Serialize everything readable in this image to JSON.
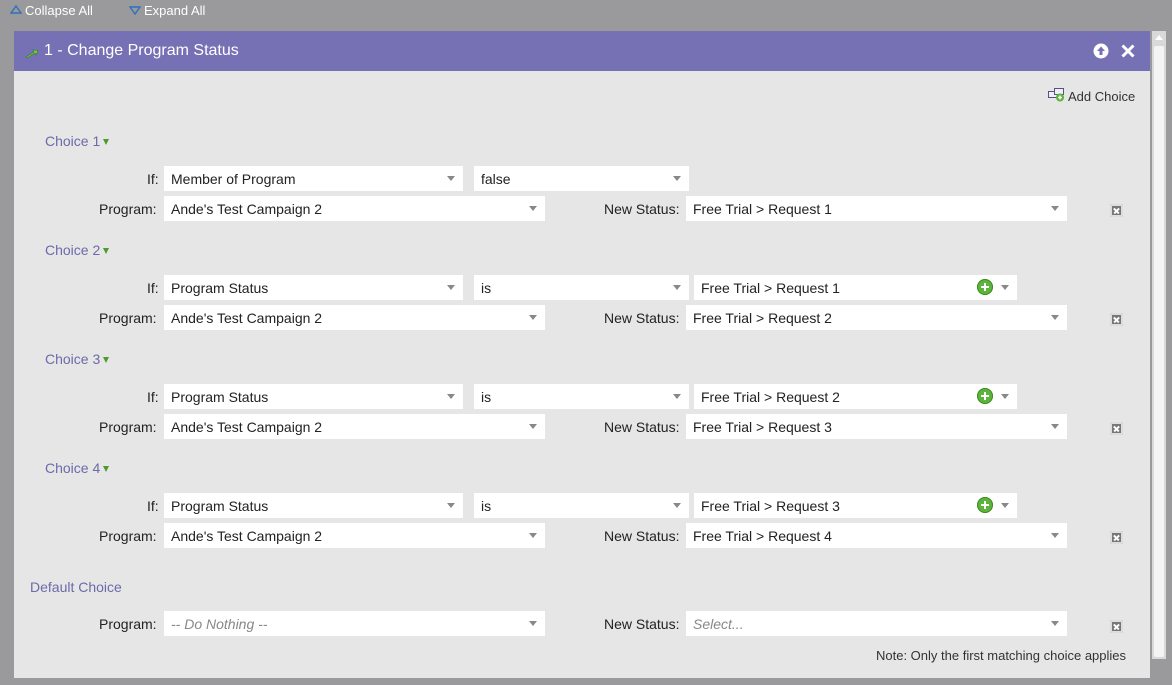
{
  "toolbar": {
    "collapse_all": "Collapse All",
    "expand_all": "Expand All"
  },
  "panel": {
    "title": "1 - Change Program Status",
    "add_choice": "Add Choice",
    "choices": [
      {
        "label": "Choice 1",
        "if_label": "If:",
        "if_field": "Member of Program",
        "if_operator": "false",
        "if_value": "",
        "program_label": "Program:",
        "program": "Ande's Test Campaign 2",
        "status_label": "New Status:",
        "status": "Free Trial > Request 1"
      },
      {
        "label": "Choice 2",
        "if_label": "If:",
        "if_field": "Program Status",
        "if_operator": "is",
        "if_value": "Free Trial > Request 1",
        "program_label": "Program:",
        "program": "Ande's Test Campaign 2",
        "status_label": "New Status:",
        "status": "Free Trial > Request 2"
      },
      {
        "label": "Choice 3",
        "if_label": "If:",
        "if_field": "Program Status",
        "if_operator": "is",
        "if_value": "Free Trial > Request 2",
        "program_label": "Program:",
        "program": "Ande's Test Campaign 2",
        "status_label": "New Status:",
        "status": "Free Trial > Request 3"
      },
      {
        "label": "Choice 4",
        "if_label": "If:",
        "if_field": "Program Status",
        "if_operator": "is",
        "if_value": "Free Trial > Request 3",
        "program_label": "Program:",
        "program": "Ande's Test Campaign 2",
        "status_label": "New Status:",
        "status": "Free Trial > Request 4"
      }
    ],
    "default_choice": {
      "label": "Default Choice",
      "program_label": "Program:",
      "program_placeholder": "-- Do Nothing --",
      "status_label": "New Status:",
      "status_placeholder": "Select..."
    },
    "note": "Note: Only the first matching choice applies"
  },
  "colors": {
    "header": "#7670b4",
    "panel_bg": "#e6e6e6",
    "choice_label": "#6c6aa9",
    "add_icon": "#5db43b"
  },
  "icons": [
    "collapse-icon",
    "expand-icon",
    "flow-step-icon",
    "move-up-icon",
    "close-icon",
    "add-choice-icon",
    "triangle-down-icon",
    "add-icon",
    "delete-icon"
  ]
}
